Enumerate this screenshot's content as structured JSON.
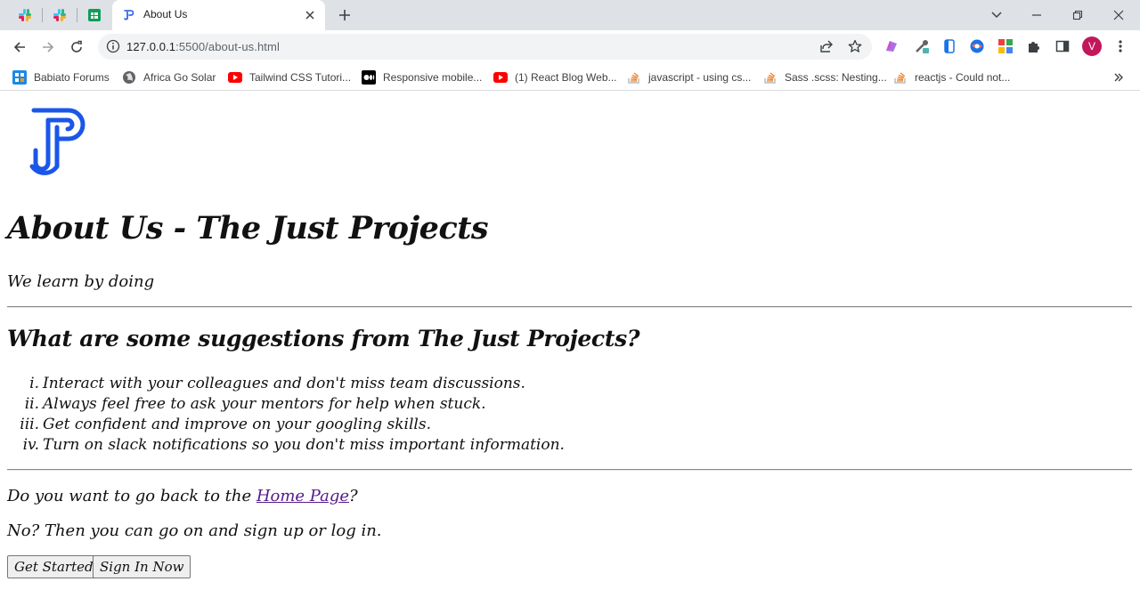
{
  "browser": {
    "pinned_tabs": [
      {
        "name": "slack-tab-1",
        "icon": "slack-icon"
      },
      {
        "name": "slack-tab-2",
        "icon": "slack-icon"
      },
      {
        "name": "sheets-tab",
        "icon": "google-sheets-icon"
      }
    ],
    "active_tab": {
      "title": "About Us",
      "icon": "just-projects-favicon"
    },
    "url_host": "127.0.0.1",
    "url_rest": ":5500/about-us.html",
    "profile_initial": "V",
    "bookmarks": [
      {
        "label": "Babiato Forums",
        "icon": "babiato-icon"
      },
      {
        "label": "Africa Go Solar",
        "icon": "globe-icon"
      },
      {
        "label": "Tailwind CSS Tutori...",
        "icon": "youtube-icon"
      },
      {
        "label": "Responsive mobile...",
        "icon": "medium-icon"
      },
      {
        "label": "(1) React Blog Web...",
        "icon": "youtube-icon"
      },
      {
        "label": "javascript - using cs...",
        "icon": "stackoverflow-icon"
      },
      {
        "label": "Sass .scss: Nesting...",
        "icon": "stackoverflow-icon"
      },
      {
        "label": "reactjs - Could not...",
        "icon": "stackoverflow-icon"
      }
    ]
  },
  "page": {
    "title": "About Us - The Just Projects",
    "tagline": "We learn by doing",
    "suggestions_heading": "What are some suggestions from The Just Projects?",
    "suggestions": [
      {
        "num": "i.",
        "text": "Interact with your colleagues and don't miss team discussions."
      },
      {
        "num": "ii.",
        "text": "Always feel free to ask your mentors for help when stuck."
      },
      {
        "num": "iii.",
        "text": "Get confident and improve on your googling skills."
      },
      {
        "num": "iv.",
        "text": "Turn on slack notifications so you don't miss important information."
      }
    ],
    "back_prefix": "Do you want to go back to the ",
    "back_link": "Home Page",
    "back_suffix": "?",
    "signup_text": "No? Then you can go on and sign up or log in.",
    "get_started_label": "Get Started",
    "sign_in_label": "Sign In Now"
  },
  "colors": {
    "logo_blue": "#1a56e8",
    "link_visited": "#551a8b",
    "avatar": "#c2185b"
  }
}
